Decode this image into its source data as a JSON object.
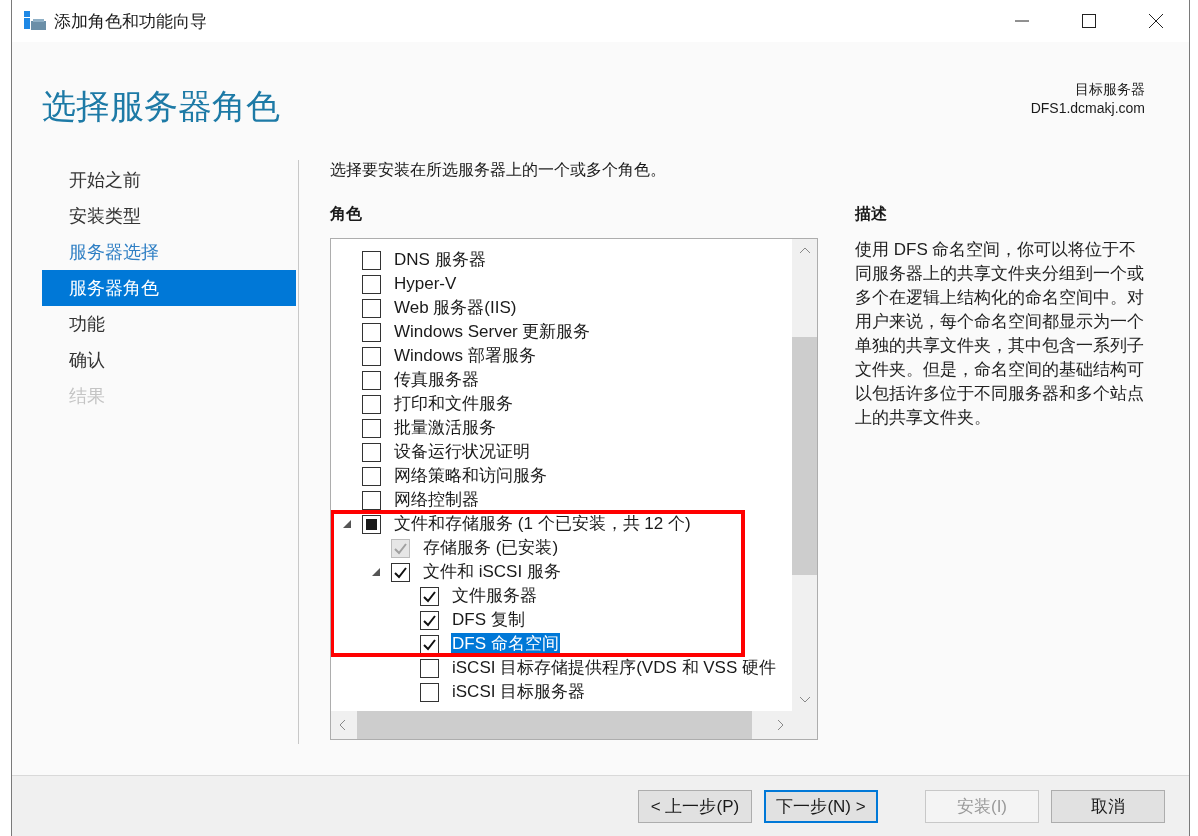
{
  "window": {
    "title": "添加角色和功能向导"
  },
  "header": {
    "title": "选择服务器角色",
    "target_label": "目标服务器",
    "target_value": "DFS1.dcmakj.com"
  },
  "nav": [
    {
      "label": "开始之前",
      "selected": false,
      "visited": false,
      "disabled": false
    },
    {
      "label": "安装类型",
      "selected": false,
      "visited": false,
      "disabled": false
    },
    {
      "label": "服务器选择",
      "selected": false,
      "visited": true,
      "disabled": false
    },
    {
      "label": "服务器角色",
      "selected": true,
      "visited": false,
      "disabled": false
    },
    {
      "label": "功能",
      "selected": false,
      "visited": false,
      "disabled": false
    },
    {
      "label": "确认",
      "selected": false,
      "visited": false,
      "disabled": false
    },
    {
      "label": "结果",
      "selected": false,
      "visited": false,
      "disabled": true
    }
  ],
  "instruction": "选择要安装在所选服务器上的一个或多个角色。",
  "roles": {
    "heading": "角色",
    "items": [
      {
        "label": "DNS 服务器",
        "checked": false,
        "partial": false,
        "disabled": false,
        "selected": false,
        "framed": false
      },
      {
        "label": "Hyper-V",
        "checked": false,
        "partial": false,
        "disabled": false,
        "selected": false,
        "framed": false
      },
      {
        "label": "Web 服务器(IIS)",
        "checked": false,
        "partial": false,
        "disabled": false,
        "selected": false,
        "framed": false
      },
      {
        "label": "Windows Server 更新服务",
        "checked": false,
        "partial": false,
        "disabled": false,
        "selected": false,
        "framed": false
      },
      {
        "label": "Windows 部署服务",
        "checked": false,
        "partial": false,
        "disabled": false,
        "selected": false,
        "framed": false
      },
      {
        "label": "传真服务器",
        "checked": false,
        "partial": false,
        "disabled": false,
        "selected": false,
        "framed": false
      },
      {
        "label": "打印和文件服务",
        "checked": false,
        "partial": false,
        "disabled": false,
        "selected": false,
        "framed": false
      },
      {
        "label": "批量激活服务",
        "checked": false,
        "partial": false,
        "disabled": false,
        "selected": false,
        "framed": false
      },
      {
        "label": "设备运行状况证明",
        "checked": false,
        "partial": false,
        "disabled": false,
        "selected": false,
        "framed": false
      },
      {
        "label": "网络策略和访问服务",
        "checked": false,
        "partial": false,
        "disabled": false,
        "selected": false,
        "framed": false
      },
      {
        "label": "网络控制器",
        "checked": false,
        "partial": false,
        "disabled": false,
        "selected": false,
        "framed": false
      },
      {
        "label": "文件和存储服务 (1 个已安装，共 12 个)",
        "checked": false,
        "partial": true,
        "disabled": false,
        "selected": false,
        "framed": true,
        "expanded": true,
        "children": [
          {
            "label": "存储服务 (已安装)",
            "checked": true,
            "partial": false,
            "disabled": true,
            "selected": false,
            "framed": true
          },
          {
            "label": "文件和 iSCSI 服务",
            "checked": true,
            "partial": false,
            "disabled": false,
            "selected": false,
            "framed": true,
            "expanded": true,
            "children": [
              {
                "label": "文件服务器",
                "checked": true,
                "partial": false,
                "disabled": false,
                "selected": false,
                "framed": true
              },
              {
                "label": "DFS 复制",
                "checked": true,
                "partial": false,
                "disabled": false,
                "selected": false,
                "framed": true
              },
              {
                "label": "DFS 命名空间",
                "checked": true,
                "partial": false,
                "disabled": false,
                "selected": true,
                "framed": true
              },
              {
                "label": "iSCSI 目标存储提供程序(VDS 和 VSS 硬件",
                "checked": false,
                "partial": false,
                "disabled": false,
                "selected": false,
                "framed": false
              },
              {
                "label": "iSCSI 目标服务器",
                "checked": false,
                "partial": false,
                "disabled": false,
                "selected": false,
                "framed": false
              }
            ]
          }
        ]
      }
    ]
  },
  "description": {
    "heading": "描述",
    "text": "使用 DFS 命名空间，你可以将位于不同服务器上的共享文件夹分组到一个或多个在逻辑上结构化的命名空间中。对用户来说，每个命名空间都显示为一个单独的共享文件夹，其中包含一系列子文件夹。但是，命名空间的基础结构可以包括许多位于不同服务器和多个站点上的共享文件夹。"
  },
  "buttons": [
    {
      "label": "< 上一步(P)",
      "default": false,
      "disabled": false
    },
    {
      "label": "下一步(N) >",
      "default": true,
      "disabled": false
    },
    {
      "label": "安装(I)",
      "default": false,
      "disabled": true
    },
    {
      "label": "取消",
      "default": false,
      "disabled": false
    }
  ]
}
